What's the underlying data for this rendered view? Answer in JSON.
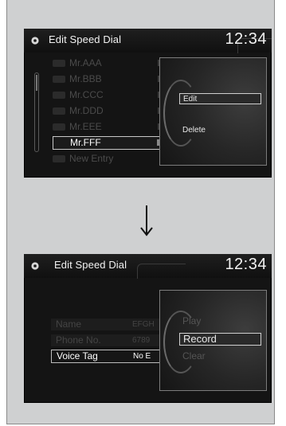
{
  "screen1": {
    "title": "Edit Speed Dial",
    "clock": "12:34",
    "list": [
      {
        "label": "Mr.AAA"
      },
      {
        "label": "Mr.BBB"
      },
      {
        "label": "Mr.CCC"
      },
      {
        "label": "Mr.DDD"
      },
      {
        "label": "Mr.EEE"
      },
      {
        "label": "Mr.FFF",
        "selected": true
      },
      {
        "label": "New Entry"
      }
    ],
    "popup": {
      "items": [
        {
          "label": "Edit"
        },
        {
          "label": "Delete"
        }
      ]
    }
  },
  "arrow_icon": "arrow-down-icon",
  "screen2": {
    "title": "Edit Speed Dial",
    "clock": "12:34",
    "rows": [
      {
        "label": "Name",
        "value": "EFGH"
      },
      {
        "label": "Phone No.",
        "value": "6789"
      },
      {
        "label": "Voice Tag",
        "value": "No E"
      }
    ],
    "popup": {
      "items": [
        {
          "label": "Play"
        },
        {
          "label": "Record"
        },
        {
          "label": "Clear"
        }
      ]
    }
  }
}
